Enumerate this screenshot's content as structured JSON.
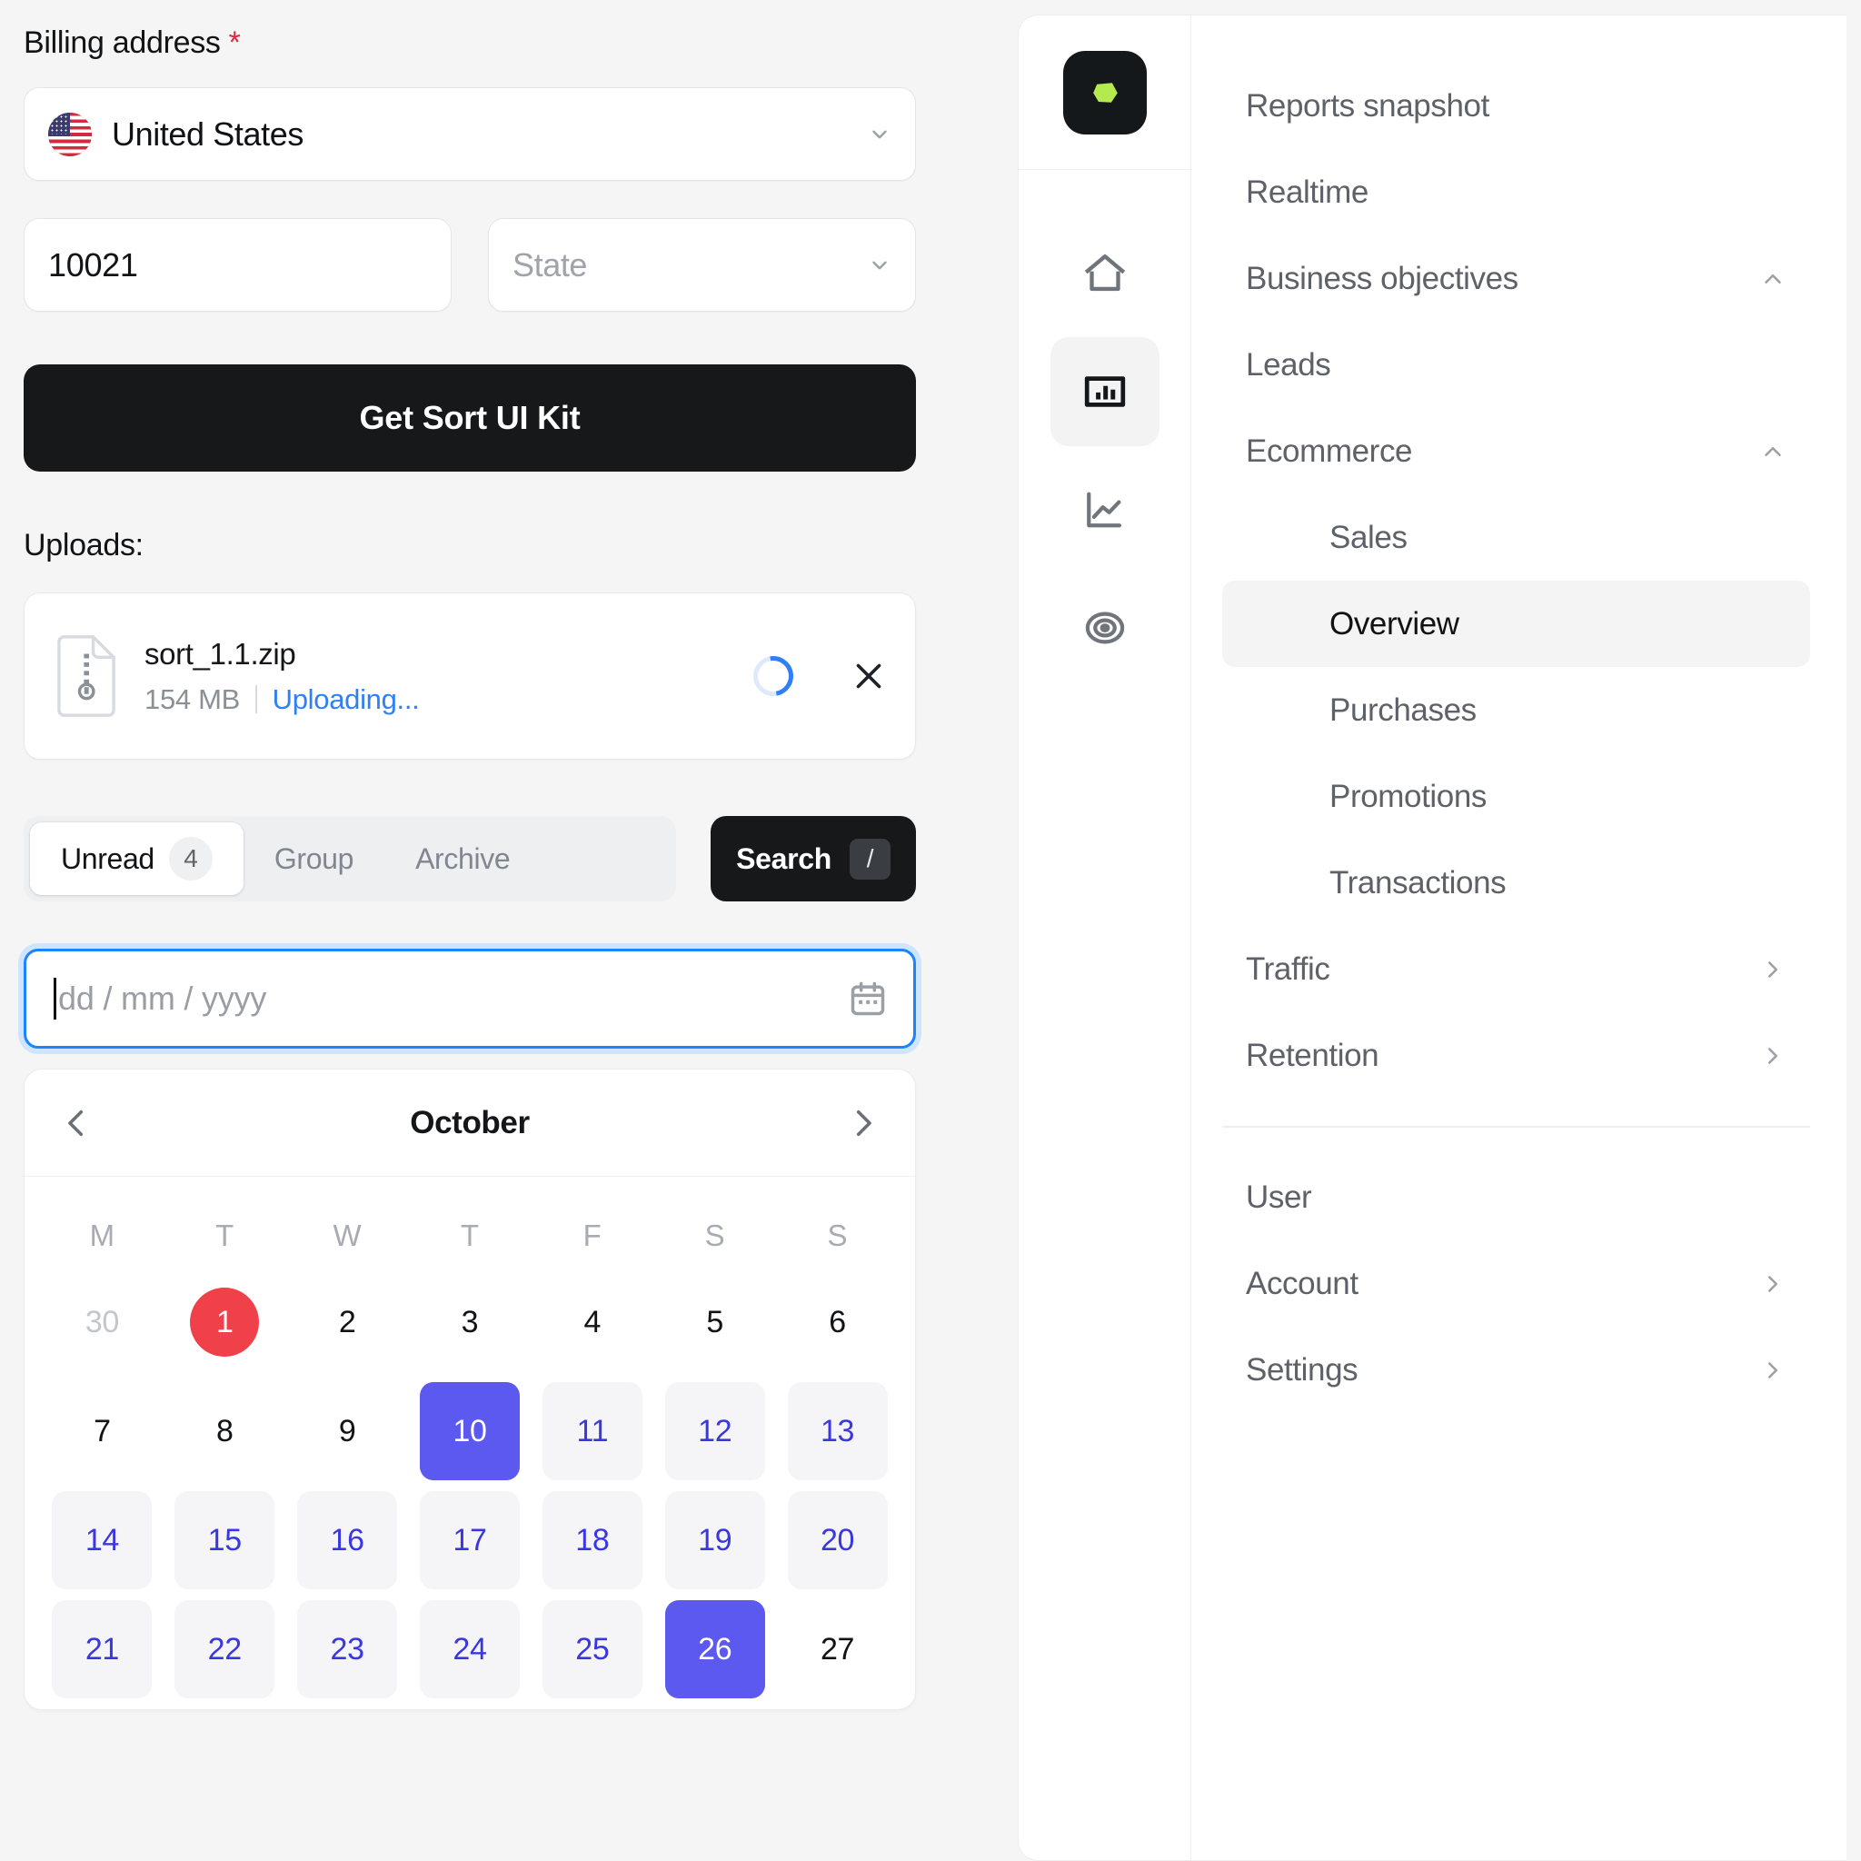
{
  "form": {
    "billing_label": "Billing address",
    "required_marker": "*",
    "country_select": {
      "value": "United States",
      "icon": "us-flag-icon",
      "chevron": "chevron-down-icon"
    },
    "zip_field": {
      "value": "10021"
    },
    "state_select": {
      "placeholder": "State",
      "chevron": "chevron-down-icon"
    },
    "cta_label": "Get Sort UI Kit",
    "uploads_label": "Uploads:",
    "upload": {
      "file_name": "sort_1.1.zip",
      "file_size": "154 MB",
      "status": "Uploading...",
      "file_icon": "zip-file-icon",
      "spinner_icon": "loading-spinner-icon",
      "remove_icon": "close-icon"
    },
    "tabs": [
      {
        "label": "Unread",
        "badge": "4",
        "active": true
      },
      {
        "label": "Group",
        "badge": "",
        "active": false
      },
      {
        "label": "Archive",
        "badge": "",
        "active": false
      }
    ],
    "search_button": {
      "label": "Search",
      "shortcut": "/"
    },
    "date_input": {
      "placeholder": "dd / mm / yyyy",
      "value": "",
      "icon": "calendar-icon"
    }
  },
  "calendar": {
    "month": "October",
    "prev_icon": "chevron-left-icon",
    "next_icon": "chevron-right-icon",
    "dow": [
      "M",
      "T",
      "W",
      "T",
      "F",
      "S",
      "S"
    ],
    "weeks": [
      [
        {
          "d": "30",
          "state": "muted"
        },
        {
          "d": "1",
          "state": "today"
        },
        {
          "d": "2",
          "state": ""
        },
        {
          "d": "3",
          "state": ""
        },
        {
          "d": "4",
          "state": ""
        },
        {
          "d": "5",
          "state": ""
        },
        {
          "d": "6",
          "state": ""
        }
      ],
      [
        {
          "d": "7",
          "state": ""
        },
        {
          "d": "8",
          "state": ""
        },
        {
          "d": "9",
          "state": ""
        },
        {
          "d": "10",
          "state": "selected"
        },
        {
          "d": "11",
          "state": "range"
        },
        {
          "d": "12",
          "state": "range"
        },
        {
          "d": "13",
          "state": "range"
        }
      ],
      [
        {
          "d": "14",
          "state": "range"
        },
        {
          "d": "15",
          "state": "range"
        },
        {
          "d": "16",
          "state": "range"
        },
        {
          "d": "17",
          "state": "range"
        },
        {
          "d": "18",
          "state": "range"
        },
        {
          "d": "19",
          "state": "range"
        },
        {
          "d": "20",
          "state": "range"
        }
      ],
      [
        {
          "d": "21",
          "state": "range"
        },
        {
          "d": "22",
          "state": "range"
        },
        {
          "d": "23",
          "state": "range"
        },
        {
          "d": "24",
          "state": "range"
        },
        {
          "d": "25",
          "state": "range"
        },
        {
          "d": "26",
          "state": "selected"
        },
        {
          "d": "27",
          "state": ""
        }
      ]
    ]
  },
  "nav": {
    "logo": "sort-logo-icon",
    "rail": [
      {
        "icon": "home-icon",
        "active": false
      },
      {
        "icon": "bar-chart-icon",
        "active": true
      },
      {
        "icon": "line-chart-icon",
        "active": false
      },
      {
        "icon": "target-icon",
        "active": false
      }
    ],
    "menu": [
      {
        "label": "Reports snapshot",
        "indent": false,
        "trailing": "",
        "current": false
      },
      {
        "label": "Realtime",
        "indent": false,
        "trailing": "",
        "current": false
      },
      {
        "label": "Business objectives",
        "indent": false,
        "trailing": "chevron-up-icon",
        "current": false
      },
      {
        "label": "Leads",
        "indent": false,
        "trailing": "",
        "current": false
      },
      {
        "label": "Ecommerce",
        "indent": false,
        "trailing": "chevron-up-icon",
        "current": false
      },
      {
        "label": "Sales",
        "indent": true,
        "trailing": "",
        "current": false
      },
      {
        "label": "Overview",
        "indent": true,
        "trailing": "",
        "current": true
      },
      {
        "label": "Purchases",
        "indent": true,
        "trailing": "",
        "current": false
      },
      {
        "label": "Promotions",
        "indent": true,
        "trailing": "",
        "current": false
      },
      {
        "label": "Transactions",
        "indent": true,
        "trailing": "",
        "current": false
      },
      {
        "label": "Traffic",
        "indent": false,
        "trailing": "chevron-right-icon",
        "current": false
      },
      {
        "label": "Retention",
        "indent": false,
        "trailing": "chevron-right-icon",
        "current": false
      }
    ],
    "menu_footer": [
      {
        "label": "User",
        "trailing": "",
        "current": false
      },
      {
        "label": "Account",
        "trailing": "chevron-right-icon",
        "current": false
      },
      {
        "label": "Settings",
        "trailing": "chevron-right-icon",
        "current": false
      }
    ]
  },
  "colors": {
    "accent_blue": "#2f80f5",
    "select_purple": "#5b59f0",
    "today_red": "#f0404a",
    "logo_green": "#b4ea4e",
    "dark": "#16181a",
    "focus_ring": "#1c84ff"
  }
}
